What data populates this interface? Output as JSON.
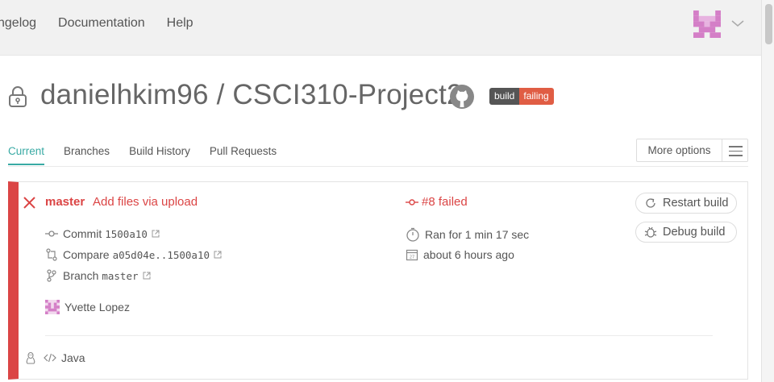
{
  "topnav": {
    "items": [
      "ngelog",
      "Documentation",
      "Help"
    ]
  },
  "repo": {
    "title": "danielhkim96 / CSCI310-Project2"
  },
  "badge": {
    "left": "build",
    "right": "failing",
    "left_color": "#555555",
    "right_color": "#e05d44"
  },
  "tabs": [
    "Current",
    "Branches",
    "Build History",
    "Pull Requests"
  ],
  "more_options": {
    "label": "More options"
  },
  "build": {
    "branch": "master",
    "message": "Add files via upload",
    "status": "#8 failed",
    "commit_label": "Commit",
    "commit_sha": "1500a10",
    "compare_label": "Compare",
    "compare_range": "a05d04e..1500a10",
    "branch_label": "Branch",
    "branch_value": "master",
    "duration": "Ran for 1 min 17 sec",
    "finished": "about 6 hours ago",
    "author": "Yvette Lopez",
    "language": "Java",
    "status_color": "#db4545"
  },
  "buttons": {
    "restart": "Restart build",
    "debug": "Debug build"
  }
}
